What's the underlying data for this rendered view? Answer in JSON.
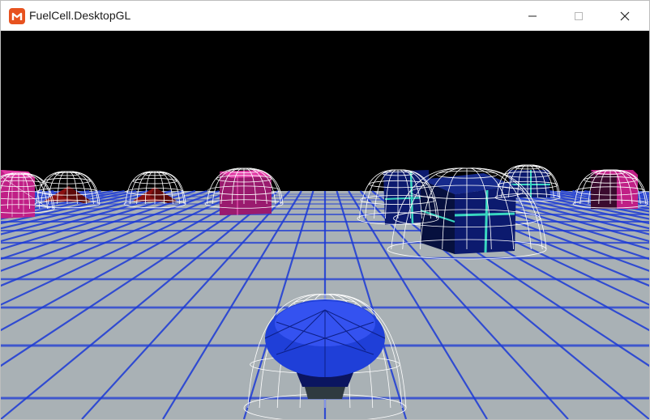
{
  "window": {
    "title": "FuelCell.DesktopGL",
    "app_icon": "monogame-logo-icon",
    "controls": [
      "minimize-icon",
      "maximize-icon",
      "close-icon"
    ]
  },
  "scene": {
    "sky_color": "#000000",
    "floor_color": "#a9b1b5",
    "grid_color": "#1c3ad6",
    "player_color": "#1f3fd8",
    "fuel_carrier_color": "#0c1a6e",
    "fuel_carrier_trim_color": "#39d6c0",
    "barrier_magenta_color": "#c01f86",
    "barrier_red_color": "#8a1010",
    "wireframe_color": "#ffffff"
  }
}
